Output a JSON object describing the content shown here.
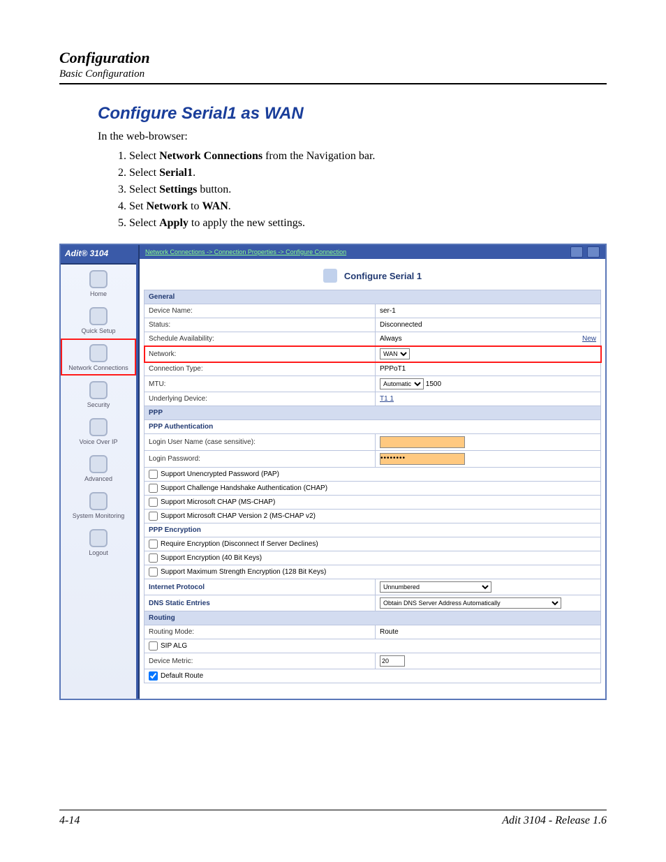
{
  "doc": {
    "header_title": "Configuration",
    "header_subtitle": "Basic Configuration",
    "section_heading": "Configure Serial1 as WAN",
    "intro": "In the web-browser:",
    "steps": [
      {
        "pre": "Select ",
        "bold": "Network Connections",
        "post": " from the Navigation bar."
      },
      {
        "pre": "Select ",
        "bold": "Serial1",
        "post": "."
      },
      {
        "pre": "Select ",
        "bold": "Settings",
        "post": " button."
      },
      {
        "pre": "Set ",
        "bold": "Network",
        "post": " to ",
        "bold2": "WAN",
        "post2": "."
      },
      {
        "pre": "Select ",
        "bold": "Apply",
        "post": " to apply the new settings."
      }
    ],
    "footer_left": "4-14",
    "footer_right": "Adit 3104 - Release 1.6"
  },
  "ui": {
    "product": "Adit® 3104",
    "breadcrumb": "Network Connections -> Connection Properties -> Configure Connection",
    "main_title": "Configure Serial 1",
    "sidebar": [
      {
        "label": "Home"
      },
      {
        "label": "Quick Setup"
      },
      {
        "label": "Network Connections",
        "highlight": true
      },
      {
        "label": "Security"
      },
      {
        "label": "Voice Over IP"
      },
      {
        "label": "Advanced"
      },
      {
        "label": "System Monitoring"
      },
      {
        "label": "Logout"
      }
    ],
    "general": {
      "header": "General",
      "device_name_label": "Device Name:",
      "device_name_value": "ser-1",
      "status_label": "Status:",
      "status_value": "Disconnected",
      "schedule_label": "Schedule Availability:",
      "schedule_value": "Always",
      "schedule_action": "New",
      "network_label": "Network:",
      "network_value": "WAN",
      "conn_type_label": "Connection Type:",
      "conn_type_value": "PPPoT1",
      "mtu_label": "MTU:",
      "mtu_mode": "Automatic",
      "mtu_value": "1500",
      "underlying_label": "Underlying Device:",
      "underlying_value": "T1 1"
    },
    "ppp": {
      "header": "PPP",
      "auth_header": "PPP Authentication",
      "login_user_label": "Login User Name (case sensitive):",
      "login_user_value": "",
      "login_pass_label": "Login Password:",
      "login_pass_value": "••••••••",
      "opt_pap": "Support Unencrypted Password (PAP)",
      "opt_chap": "Support Challenge Handshake Authentication (CHAP)",
      "opt_mschap": "Support Microsoft CHAP (MS-CHAP)",
      "opt_mschap2": "Support Microsoft CHAP Version 2 (MS-CHAP v2)",
      "enc_header": "PPP Encryption",
      "opt_req_enc": "Require Encryption (Disconnect If Server Declines)",
      "opt_40bit": "Support Encryption (40 Bit Keys)",
      "opt_128bit": "Support Maximum Strength Encryption (128 Bit Keys)"
    },
    "ip": {
      "proto_label": "Internet Protocol",
      "proto_value": "Unnumbered",
      "dns_label": "DNS Static Entries",
      "dns_value": "Obtain DNS Server Address Automatically"
    },
    "routing": {
      "header": "Routing",
      "mode_label": "Routing Mode:",
      "mode_value": "Route",
      "sip_alg": "SIP ALG",
      "metric_label": "Device Metric:",
      "metric_value": "20",
      "default_route": "Default Route"
    }
  }
}
